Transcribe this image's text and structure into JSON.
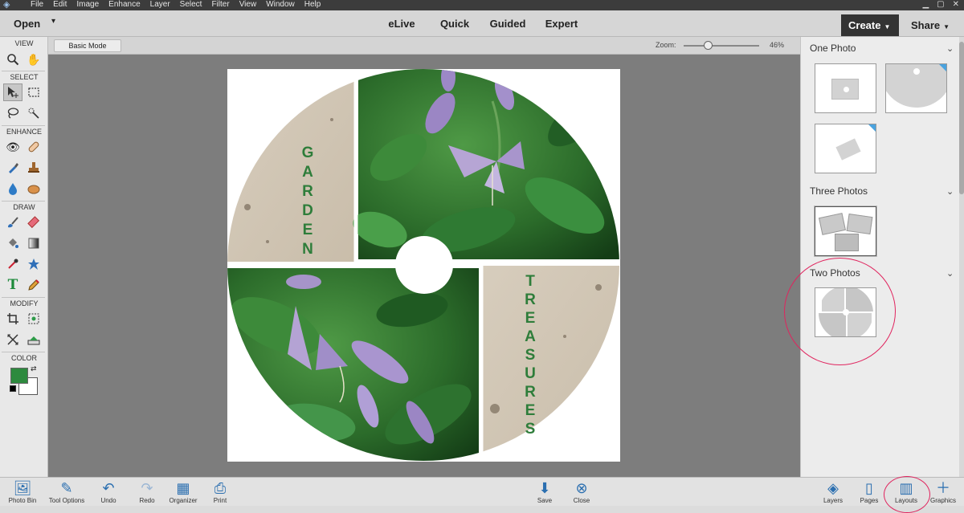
{
  "menubar": {
    "items": [
      "File",
      "Edit",
      "Image",
      "Enhance",
      "Layer",
      "Select",
      "Filter",
      "View",
      "Window",
      "Help"
    ]
  },
  "topbar": {
    "open_label": "Open",
    "modes": [
      "eLive",
      "Quick",
      "Guided",
      "Expert"
    ],
    "create_label": "Create",
    "share_label": "Share"
  },
  "toolbox": {
    "sections": [
      "VIEW",
      "SELECT",
      "ENHANCE",
      "DRAW",
      "MODIFY",
      "COLOR"
    ],
    "foreground_color": "#2d8a3e",
    "background_color": "#ffffff"
  },
  "options": {
    "basic_mode_label": "Basic Mode",
    "zoom_label": "Zoom:",
    "zoom_value": "46%",
    "zoom_fraction": 0.2
  },
  "document": {
    "word_top": "GARDEN",
    "word_bottom": "TREASURES",
    "text_color": "#2e7d3a"
  },
  "panel": {
    "sections": [
      {
        "title": "One Photo"
      },
      {
        "title": "Three Photos"
      },
      {
        "title": "Two Photos"
      }
    ]
  },
  "taskbar": {
    "items": [
      {
        "label": "Photo Bin",
        "icon": "image-icon"
      },
      {
        "label": "Tool Options",
        "icon": "tool-options-icon"
      },
      {
        "label": "Undo",
        "icon": "undo-icon"
      },
      {
        "label": "Redo",
        "icon": "redo-icon"
      },
      {
        "label": "Organizer",
        "icon": "organizer-icon"
      },
      {
        "label": "Print",
        "icon": "print-icon"
      },
      {
        "label": "Save",
        "icon": "save-icon"
      },
      {
        "label": "Close",
        "icon": "close-icon"
      },
      {
        "label": "Layers",
        "icon": "layers-icon"
      },
      {
        "label": "Pages",
        "icon": "pages-icon"
      },
      {
        "label": "Layouts",
        "icon": "layouts-icon"
      },
      {
        "label": "Graphics",
        "icon": "graphics-icon"
      }
    ]
  },
  "annotation_color": "#e0245e"
}
